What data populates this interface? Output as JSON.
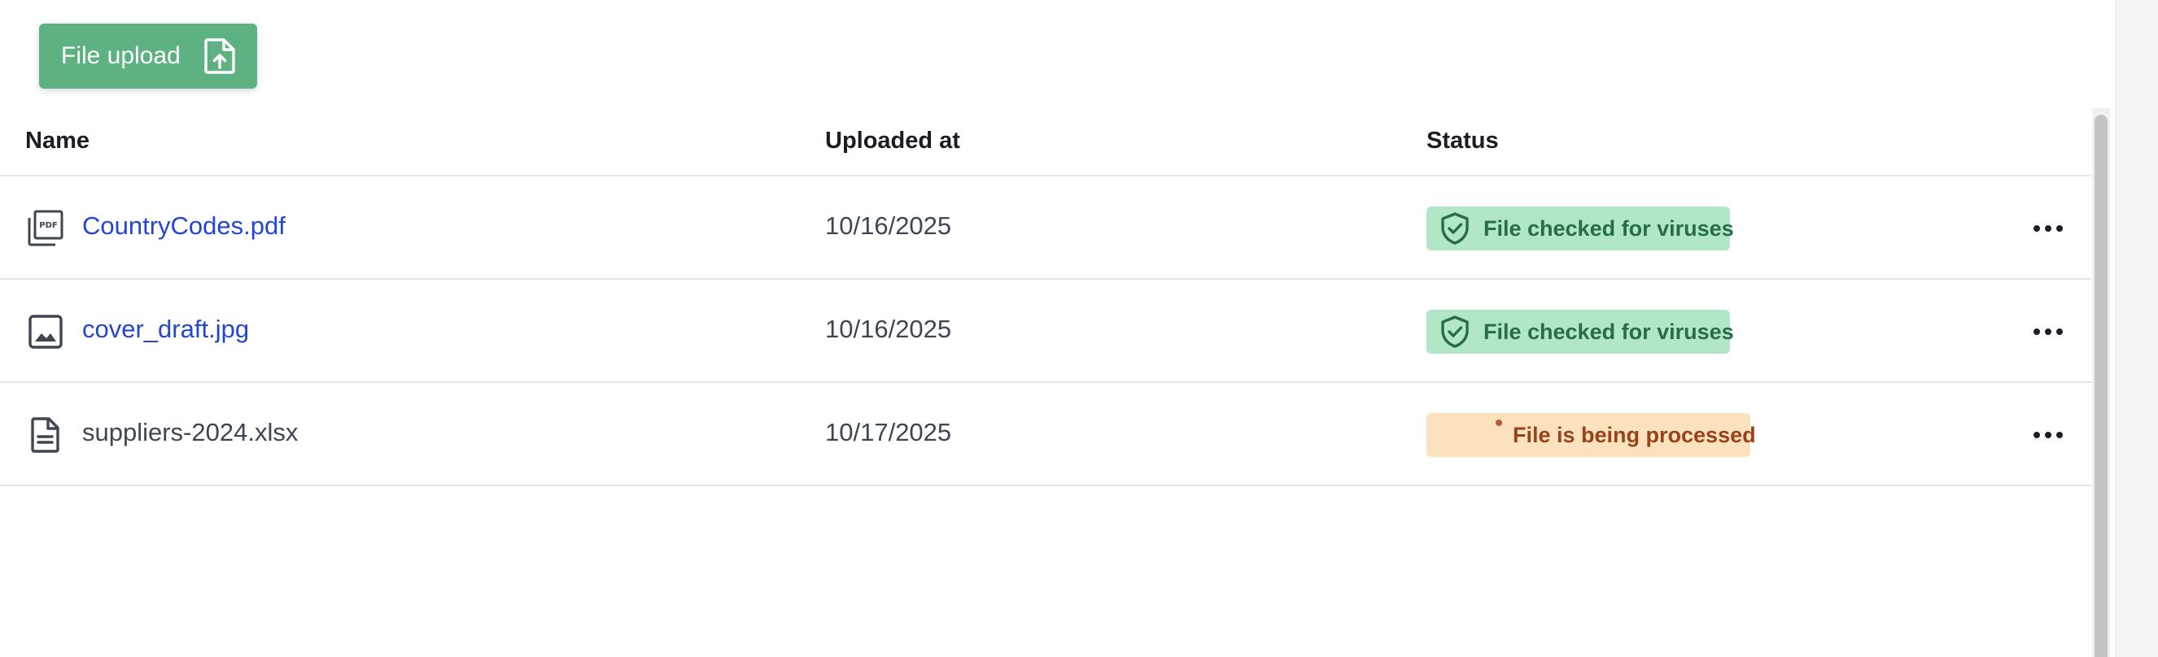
{
  "toolbar": {
    "upload_label": "File upload",
    "upload_icon": "file-upload-icon",
    "accent_color": "#5db183"
  },
  "table": {
    "columns": {
      "name": "Name",
      "uploaded_at": "Uploaded at",
      "status": "Status"
    },
    "rows": [
      {
        "icon": "pdf-file-icon",
        "name": "CountryCodes.pdf",
        "uploaded_at": "10/16/2025",
        "status": "File checked for viruses",
        "status_kind": "success",
        "status_icon": "shield-check-icon"
      },
      {
        "icon": "image-file-icon",
        "name": "cover_draft.jpg",
        "uploaded_at": "10/16/2025",
        "status": "File checked for viruses",
        "status_kind": "success",
        "status_icon": "shield-check-icon"
      },
      {
        "icon": "document-file-icon",
        "name": "suppliers-2024.xlsx",
        "uploaded_at": "10/17/2025",
        "status": "File is being processed",
        "status_kind": "processing",
        "status_icon": "spinner-icon"
      }
    ]
  },
  "colors": {
    "link": "#2446d0",
    "success_bg": "#b1e6c6",
    "success_text": "#286c4a",
    "processing_bg": "#fbe2bf",
    "processing_text": "#99431a"
  }
}
